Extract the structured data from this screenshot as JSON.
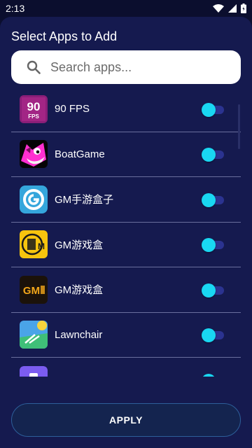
{
  "status_bar": {
    "time": "2:13"
  },
  "sheet": {
    "title": "Select Apps to Add"
  },
  "search": {
    "placeholder": "Search apps...",
    "value": ""
  },
  "apps": [
    {
      "name": "90 FPS",
      "enabled": true
    },
    {
      "name": "BoatGame",
      "enabled": true
    },
    {
      "name": "GM手游盒子",
      "enabled": true
    },
    {
      "name": "GM游戏盒",
      "enabled": true
    },
    {
      "name": "GM游戏盒",
      "enabled": true
    },
    {
      "name": "Lawnchair",
      "enabled": true
    },
    {
      "name": "",
      "enabled": true
    }
  ],
  "icons": {
    "app0": {
      "text": "90",
      "sub": "FPS"
    },
    "app4": {
      "text": "GM"
    }
  },
  "apply_button": {
    "label": "APPLY"
  },
  "colors": {
    "background": "#0b0e2e",
    "sheet": "#151a4f",
    "toggle_on": "#19d7f2",
    "toggle_track": "#2b3390",
    "divider": "#b9bdf0"
  }
}
